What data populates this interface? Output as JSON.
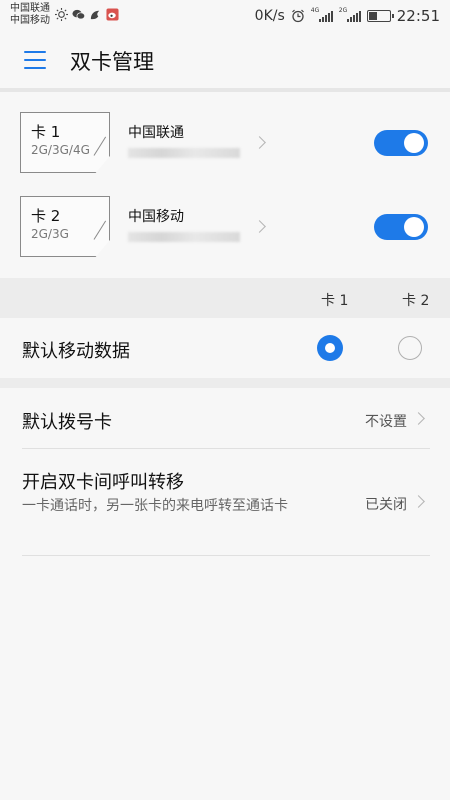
{
  "status_bar": {
    "carrier_1": "中国联通",
    "carrier_2": "中国移动",
    "net_speed": "0K/s",
    "signal_1_tag": "4G",
    "signal_2_tag": "2G",
    "battery_level": 0.4,
    "time": "22:51",
    "icons": [
      "brightness-icon",
      "wechat-icon",
      "uc-browser-icon",
      "weibo-icon",
      "alarm-icon",
      "signal-icon",
      "battery-icon"
    ]
  },
  "header": {
    "title": "双卡管理"
  },
  "sims": [
    {
      "card_label": "卡 1",
      "network": "2G/3G/4G",
      "carrier": "中国联通",
      "enabled": true
    },
    {
      "card_label": "卡 2",
      "network": "2G/3G",
      "carrier": "中国移动",
      "enabled": true
    }
  ],
  "columns": {
    "card1": "卡 1",
    "card2": "卡 2"
  },
  "default_data": {
    "label": "默认移动数据",
    "selected": "card1"
  },
  "default_dial": {
    "label": "默认拨号卡",
    "value": "不设置"
  },
  "call_forward": {
    "label": "开启双卡间呼叫转移",
    "description": "一卡通话时，另一张卡的来电呼转至通话卡",
    "value": "已关闭"
  },
  "colors": {
    "accent": "#1e7ae8",
    "background": "#f7f7f7",
    "section_gray": "#ececec"
  }
}
